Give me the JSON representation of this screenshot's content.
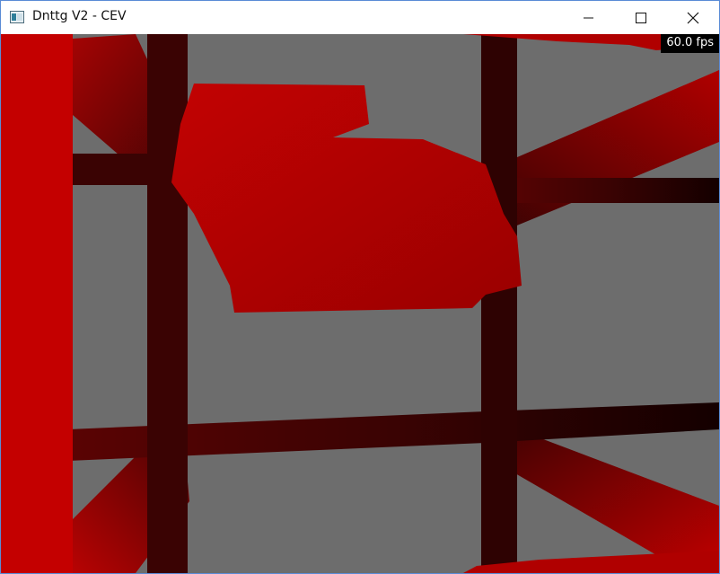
{
  "window": {
    "title": "Dnttg V2 - CEV",
    "icon": "app-window-icon",
    "controls": {
      "minimize": "minimize-icon",
      "maximize": "maximize-icon",
      "close": "close-icon"
    }
  },
  "viewport": {
    "fps": "60.0 fps",
    "colors": {
      "background": "#6d6d6d",
      "pillar": "#c40000",
      "beam": "#3a0303",
      "blob": "#b00000"
    }
  }
}
